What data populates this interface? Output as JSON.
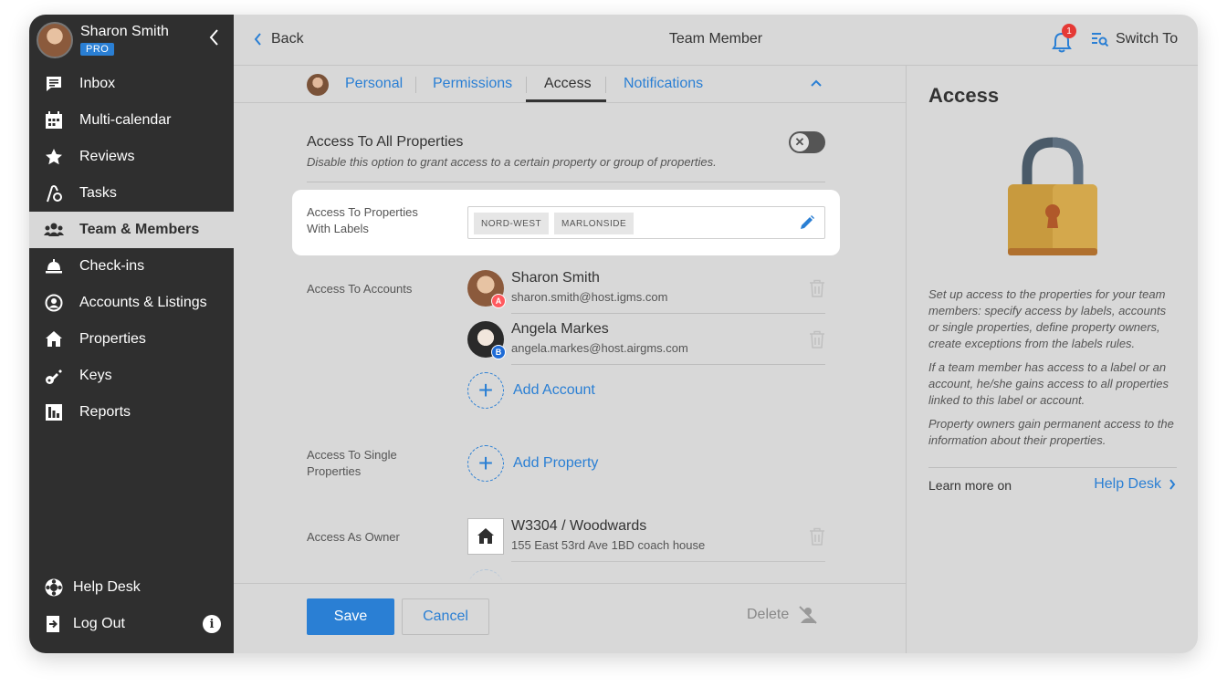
{
  "user": {
    "name": "Sharon Smith",
    "badge": "PRO"
  },
  "sidebar": {
    "items": [
      {
        "label": "Inbox",
        "icon": "inbox-icon"
      },
      {
        "label": "Multi-calendar",
        "icon": "calendar-icon"
      },
      {
        "label": "Reviews",
        "icon": "star-icon"
      },
      {
        "label": "Tasks",
        "icon": "tasks-icon"
      },
      {
        "label": "Team & Members",
        "icon": "team-icon"
      },
      {
        "label": "Check-ins",
        "icon": "bell-desk-icon"
      },
      {
        "label": "Accounts & Listings",
        "icon": "account-icon"
      },
      {
        "label": "Properties",
        "icon": "home-icon"
      },
      {
        "label": "Keys",
        "icon": "key-icon"
      },
      {
        "label": "Reports",
        "icon": "reports-icon"
      }
    ],
    "active": "Team & Members",
    "help": "Help Desk",
    "logout": "Log Out",
    "info_symbol": "i"
  },
  "header": {
    "back": "Back",
    "title": "Team Member",
    "notification_count": "1",
    "switch_to": "Switch To"
  },
  "tabs": [
    {
      "label": "Personal"
    },
    {
      "label": "Permissions"
    },
    {
      "label": "Access"
    },
    {
      "label": "Notifications"
    }
  ],
  "access": {
    "all_title": "Access To All Properties",
    "all_desc": "Disable this option to grant access to a certain property or group of properties.",
    "all_enabled": false,
    "labels_label": "Access To Properties With Labels",
    "labels": [
      "NORD-WEST",
      "MARLONSIDE"
    ],
    "accounts_label": "Access To Accounts",
    "accounts": [
      {
        "name": "Sharon Smith",
        "email": "sharon.smith@host.igms.com",
        "source": "airbnb"
      },
      {
        "name": "Angela Markes",
        "email": "angela.markes@host.airgms.com",
        "source": "booking"
      }
    ],
    "add_account": "Add Account",
    "single_label": "Access To Single Properties",
    "add_property": "Add Property",
    "owner_label": "Access As Owner",
    "owner_property": {
      "name": "W3304 / Woodwards",
      "address": "155 East 53rd Ave 1BD coach house"
    }
  },
  "footer": {
    "save": "Save",
    "cancel": "Cancel",
    "delete": "Delete"
  },
  "panel": {
    "title": "Access",
    "p1": "Set up access to the properties for your team members: specify access by labels, accounts or single properties, define property owners, create exceptions from the labels rules.",
    "p2": "If a team member has access to a label or an account, he/she gains access to all properties linked to this label or account.",
    "p3": "Property owners gain permanent access to the information about their properties.",
    "learn_more": "Learn more on",
    "help_link": "Help Desk"
  },
  "colors": {
    "accent": "#2a7fd4",
    "sidebar": "#2f2f2f",
    "badge_red": "#e53935"
  }
}
